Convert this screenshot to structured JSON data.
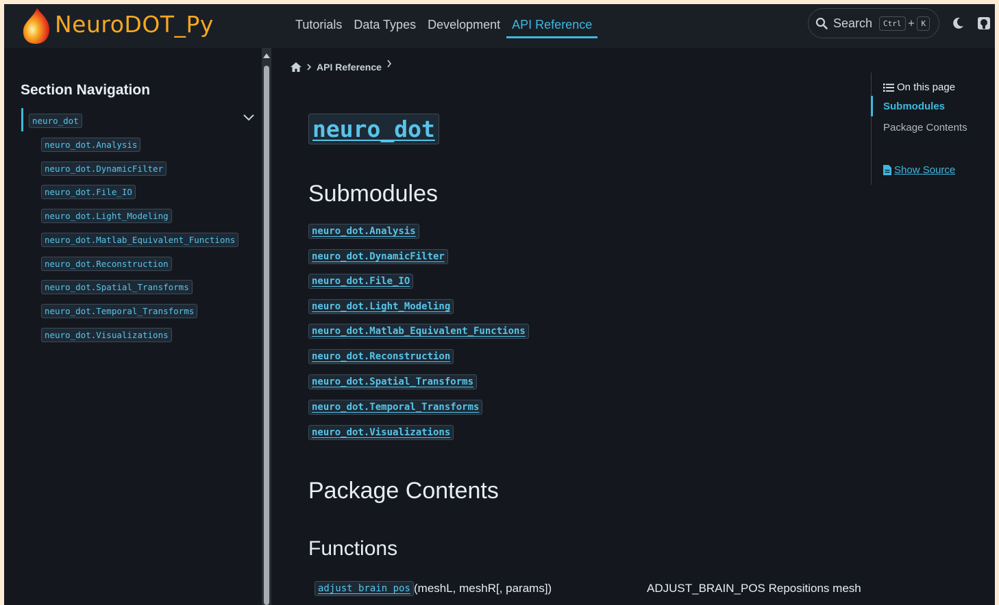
{
  "header": {
    "brand": "NeuroDOT_Py",
    "nav": [
      "Tutorials",
      "Data Types",
      "Development",
      "API Reference"
    ],
    "active_nav": "API Reference",
    "search_label": "Search",
    "kbd_ctrl": "Ctrl",
    "kbd_plus": "+",
    "kbd_k": "K"
  },
  "sidebar": {
    "title": "Section Navigation",
    "root": "neuro_dot",
    "items": [
      "neuro_dot.Analysis",
      "neuro_dot.DynamicFilter",
      "neuro_dot.File_IO",
      "neuro_dot.Light_Modeling",
      "neuro_dot.Matlab_Equivalent_Functions",
      "neuro_dot.Reconstruction",
      "neuro_dot.Spatial_Transforms",
      "neuro_dot.Temporal_Transforms",
      "neuro_dot.Visualizations"
    ]
  },
  "breadcrumb": {
    "current": "API Reference"
  },
  "main": {
    "title": "neuro_dot",
    "submodules_heading": "Submodules",
    "submodules": [
      "neuro_dot.Analysis",
      "neuro_dot.DynamicFilter",
      "neuro_dot.File_IO",
      "neuro_dot.Light_Modeling",
      "neuro_dot.Matlab_Equivalent_Functions",
      "neuro_dot.Reconstruction",
      "neuro_dot.Spatial_Transforms",
      "neuro_dot.Temporal_Transforms",
      "neuro_dot.Visualizations"
    ],
    "package_heading": "Package Contents",
    "functions_heading": "Functions",
    "function": {
      "name": "adjust_brain_pos",
      "signature": "(meshL, meshR[, params])",
      "description": "ADJUST_BRAIN_POS Repositions mesh"
    }
  },
  "toc": {
    "title": "On this page",
    "items": [
      "Submodules",
      "Package Contents"
    ],
    "show_source": "Show Source"
  },
  "colors": {
    "accent": "#3fb8e0",
    "brand": "#f6a821",
    "background": "#14181e"
  }
}
